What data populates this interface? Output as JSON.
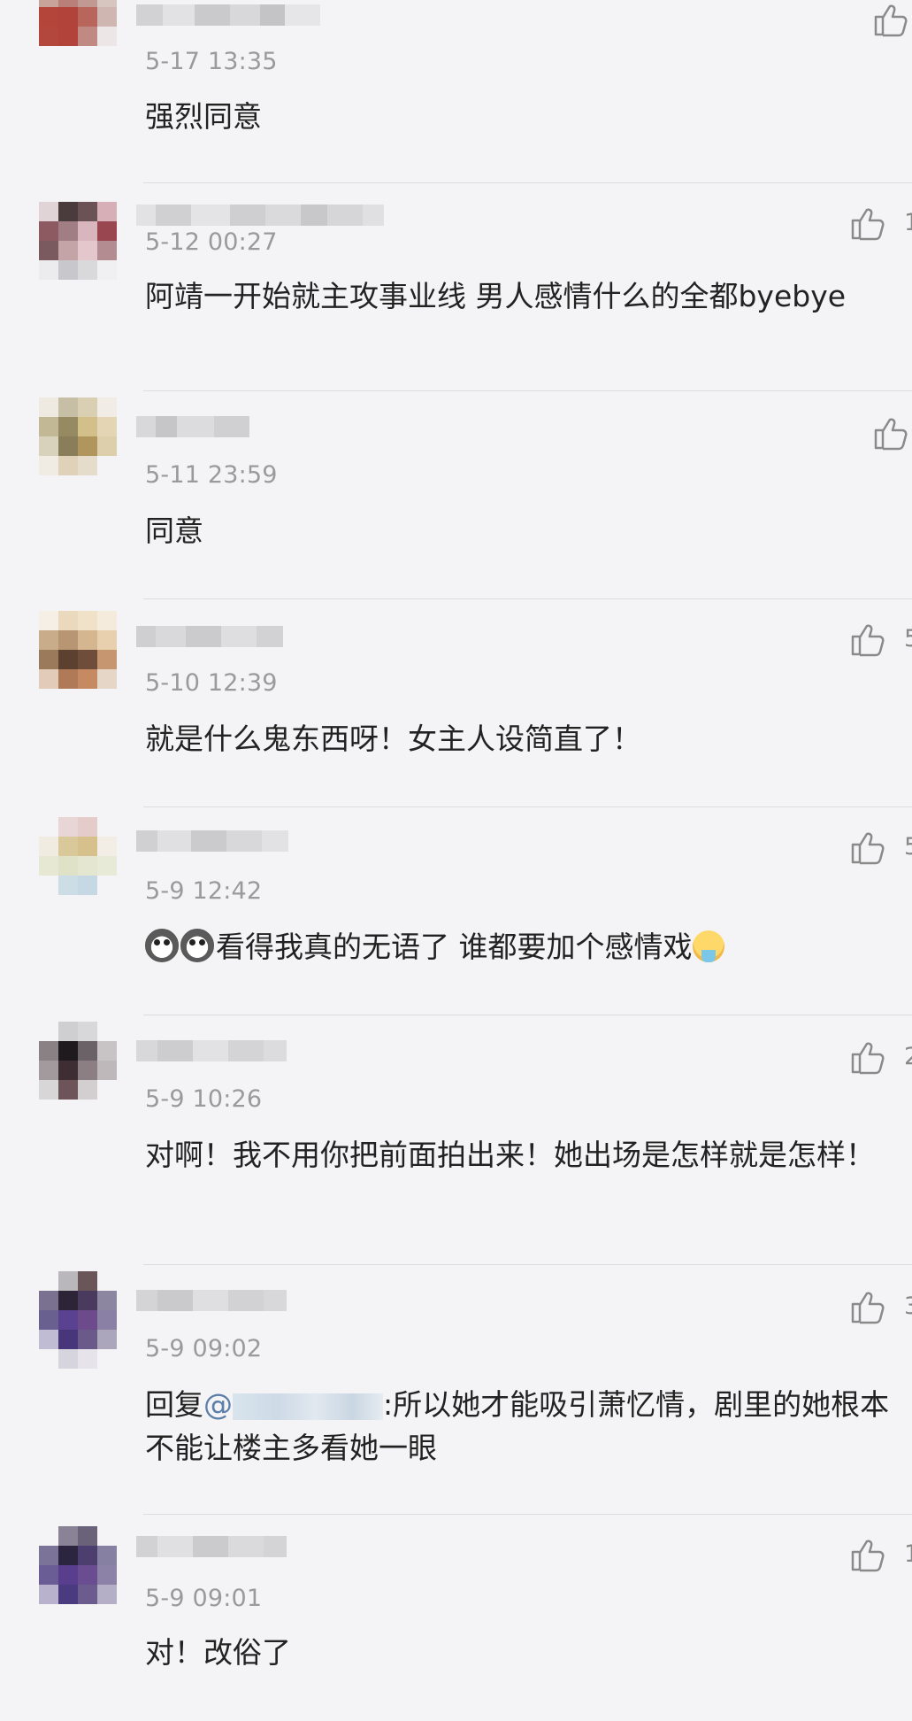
{
  "comments": [
    {
      "timestamp": "5-17 13:35",
      "text": "强烈同意",
      "likes": ""
    },
    {
      "timestamp": "5-12 00:27",
      "text": "阿靖一开始就主攻事业线 男人感情什么的全都byebye",
      "likes": "1"
    },
    {
      "timestamp": "5-11 23:59",
      "text": "同意",
      "likes": ""
    },
    {
      "timestamp": "5-10 12:39",
      "text": "就是什么鬼东西呀！女主人设简直了！",
      "likes": "5"
    },
    {
      "timestamp": "5-9 12:42",
      "text": "看得我真的无语了 谁都要加个感情戏",
      "likes": "5"
    },
    {
      "timestamp": "5-9 10:26",
      "text": "对啊！我不用你把前面拍出来！她出场是怎样就是怎样！",
      "likes": "2"
    },
    {
      "timestamp": "5-9 09:02",
      "reply_prefix": "回复",
      "mention_at": "@",
      "text": ":所以她才能吸引萧忆情，剧里的她根本不能让楼主多看她一眼",
      "likes": "3"
    },
    {
      "timestamp": "5-9 09:01",
      "text": "对！改俗了",
      "likes": "1"
    }
  ],
  "colors": {
    "background": "#f4f4f6",
    "timestamp": "#9a9a9a",
    "text": "#222222",
    "mention": "#5b7fa8",
    "divider": "#dcdcdf"
  },
  "icons": {
    "like": "thumbs-up-outline-icon",
    "emoji_dog": "husky-dog-emoji",
    "emoji_vomit": "vomit-face-emoji"
  }
}
